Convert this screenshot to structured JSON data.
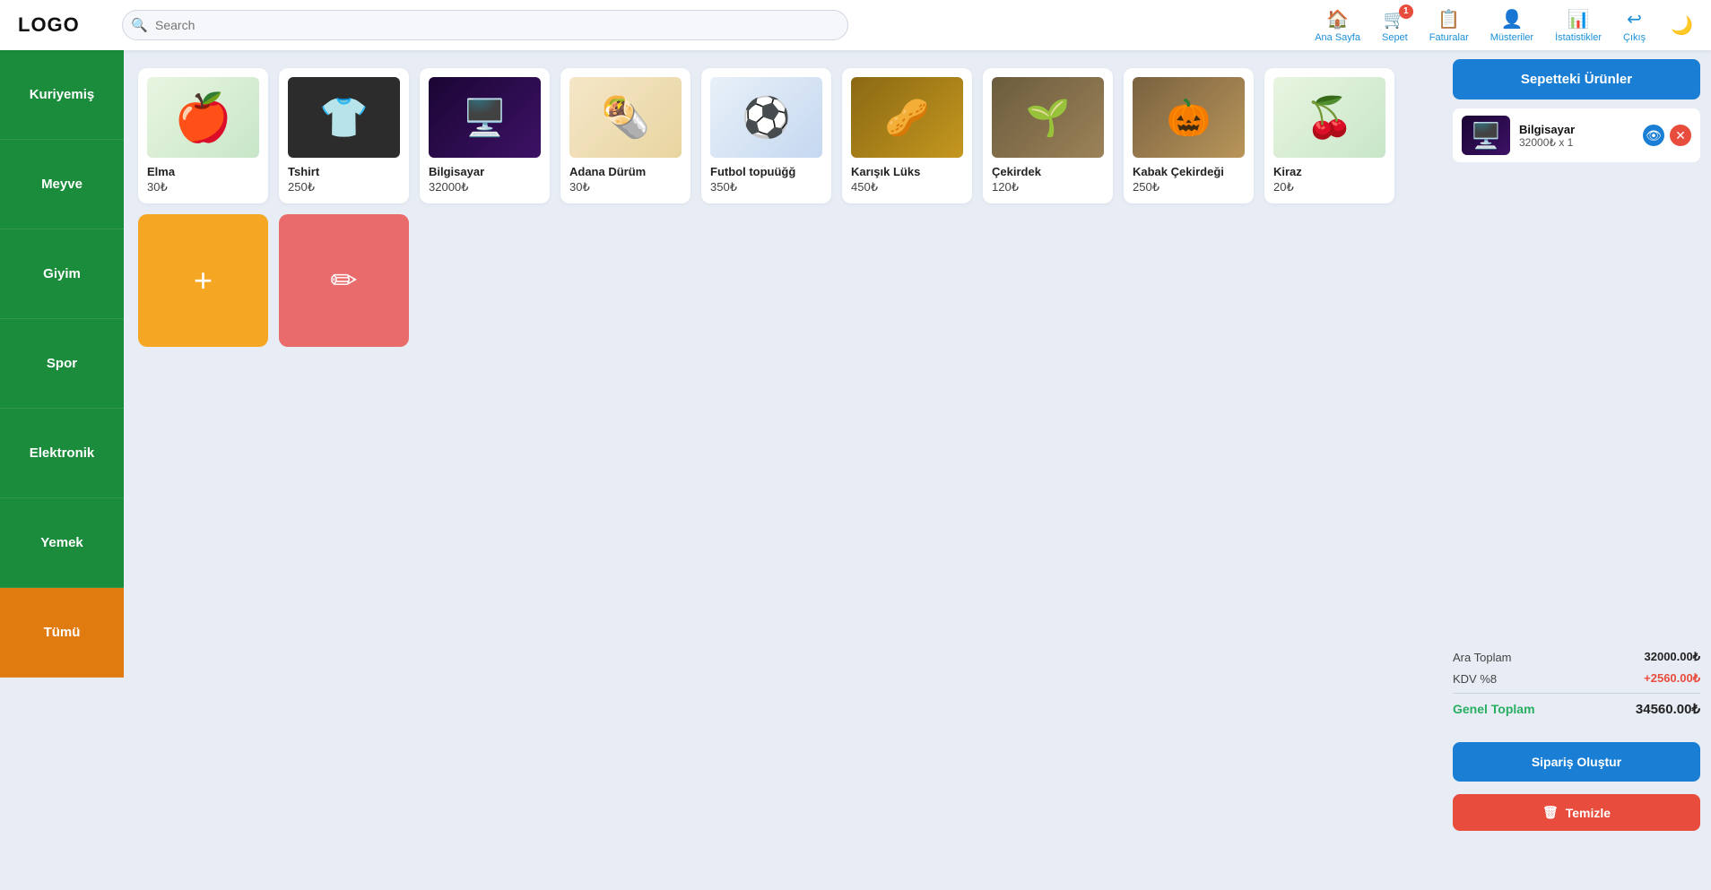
{
  "header": {
    "logo": "LOGO",
    "search_placeholder": "Search",
    "nav": [
      {
        "id": "ana-sayfa",
        "label": "Ana Sayfa",
        "icon": "🏠",
        "badge": null
      },
      {
        "id": "sepet",
        "label": "Sepet",
        "icon": "🛒",
        "badge": "1"
      },
      {
        "id": "faturalar",
        "label": "Faturalar",
        "icon": "📋",
        "badge": null
      },
      {
        "id": "musteriler",
        "label": "Müsteriler",
        "icon": "👤",
        "badge": null
      },
      {
        "id": "istatistikler",
        "label": "İstatistikler",
        "icon": "📊",
        "badge": null
      },
      {
        "id": "cikis",
        "label": "Çıkış",
        "icon": "↩",
        "badge": null
      }
    ],
    "dark_toggle": "🌙"
  },
  "sidebar": {
    "items": [
      {
        "id": "kuriyemis",
        "label": "Kuriyemiş",
        "color": "green"
      },
      {
        "id": "meyve",
        "label": "Meyve",
        "color": "green"
      },
      {
        "id": "giyim",
        "label": "Giyim",
        "color": "green"
      },
      {
        "id": "spor",
        "label": "Spor",
        "color": "green"
      },
      {
        "id": "elektronik",
        "label": "Elektronik",
        "color": "green"
      },
      {
        "id": "yemek",
        "label": "Yemek",
        "color": "green"
      },
      {
        "id": "tumu",
        "label": "Tümü",
        "color": "orange"
      }
    ]
  },
  "products": [
    {
      "id": "elma",
      "name": "Elma",
      "price": "30₺",
      "img": "apple"
    },
    {
      "id": "tshirt",
      "name": "Tshirt",
      "price": "250₺",
      "img": "tshirt"
    },
    {
      "id": "bilgisayar",
      "name": "Bilgisayar",
      "price": "32000₺",
      "img": "computer"
    },
    {
      "id": "adana-durum",
      "name": "Adana Dürüm",
      "price": "30₺",
      "img": "durum"
    },
    {
      "id": "futbol-topu",
      "name": "Futbol topuüğğ",
      "price": "350₺",
      "img": "football"
    },
    {
      "id": "karisik-luks",
      "name": "Karışık Lüks",
      "price": "450₺",
      "img": "nuts"
    },
    {
      "id": "cekirdek",
      "name": "Çekirdek",
      "price": "120₺",
      "img": "seeds"
    },
    {
      "id": "kabak-cekirde",
      "name": "Kabak Çekirdeği",
      "price": "250₺",
      "img": "pumpkin"
    },
    {
      "id": "kiraz",
      "name": "Kiraz",
      "price": "20₺",
      "img": "cherry"
    }
  ],
  "actions": [
    {
      "id": "add",
      "icon": "+",
      "type": "add"
    },
    {
      "id": "edit",
      "icon": "✏",
      "type": "edit"
    }
  ],
  "cart": {
    "header": "Sepetteki Ürünler",
    "items": [
      {
        "id": "bilgisayar-cart",
        "name": "Bilgisayar",
        "price": "32000₺ x 1",
        "img": "computer"
      }
    ],
    "summary": {
      "ara_toplam_label": "Ara Toplam",
      "ara_toplam_value": "32000.00₺",
      "kdv_label": "KDV %8",
      "kdv_value": "+2560.00₺",
      "genel_toplam_label": "Genel Toplam",
      "genel_toplam_value": "34560.00₺"
    },
    "btn_siparis": "Sipariş Oluştur",
    "btn_temizle": "Temizle"
  }
}
